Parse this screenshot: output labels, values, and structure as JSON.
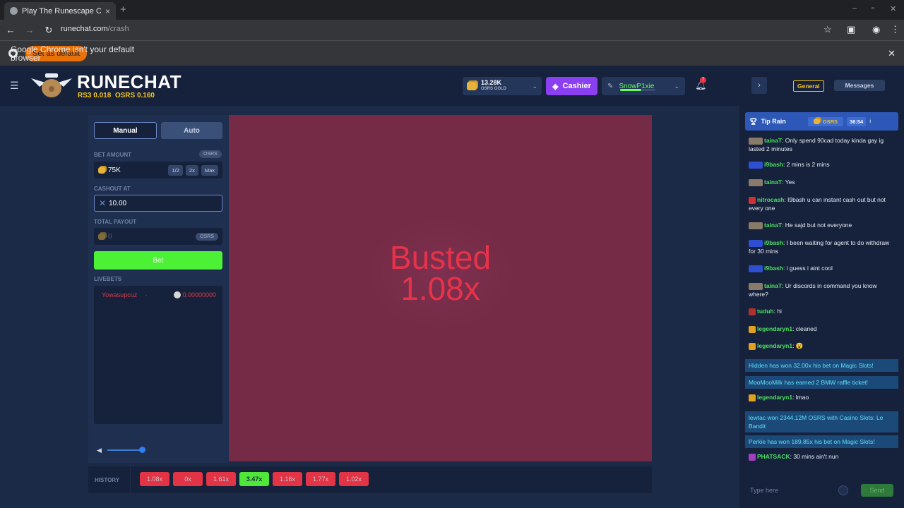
{
  "browser": {
    "tab_title": "Play The Runescape Cra",
    "tab_close": "×",
    "new_tab": "+",
    "minimize": "–",
    "maximize": "▫",
    "close": "✕",
    "url_host": "runechat.com",
    "url_path": "/crash",
    "infobar_message": "Google Chrome isn't your default browser",
    "set_default_label": "Set as default"
  },
  "header": {
    "logo_text": "RUNECHAT",
    "rs3_price": "RS3 0.018",
    "osrs_price": "OSRS 0.160",
    "balance_amount": "13.28K",
    "balance_label": "OSRS GOLD",
    "cashier_label": "Cashier",
    "username": "SnowP1xie",
    "notification_count": "7"
  },
  "bet_panel": {
    "tabs": [
      "Manual",
      "Auto"
    ],
    "active_tab": "Manual",
    "bet_amount_label": "BET AMOUNT",
    "bet_currency": "OSRS",
    "bet_amount_value": "75K",
    "bet_buttons": [
      "1/2",
      "2x",
      "Max"
    ],
    "cashout_label": "CASHOUT AT",
    "cashout_value": "10.00",
    "total_payout_label": "TOTAL PAYOUT",
    "total_payout_value": "0",
    "payout_currency": "OSRS",
    "bet_button_label": "Bet",
    "livebets_label": "LIVEBETS",
    "livebets": [
      {
        "user": "Yowasupcuz",
        "status": "-",
        "amount": "0.00000000"
      }
    ],
    "volume_percent": 100
  },
  "game": {
    "status": "Busted",
    "multiplier": "1.08x"
  },
  "history": {
    "label": "HISTORY",
    "items": [
      {
        "value": "1.08x",
        "win": false
      },
      {
        "value": "0x",
        "win": false
      },
      {
        "value": "1.61x",
        "win": false
      },
      {
        "value": "3.47x",
        "win": true
      },
      {
        "value": "1.16x",
        "win": false
      },
      {
        "value": "1.77x",
        "win": false
      },
      {
        "value": "1.02x",
        "win": false
      }
    ]
  },
  "chat": {
    "tab_general": "General",
    "tab_messages": "Messages",
    "tip_rain_label": "Tip Rain",
    "tip_rain_currency": "OSRS",
    "tip_rain_timer": "36:54",
    "tip_rain_info": "i",
    "input_placeholder": "Type here",
    "send_label": "Send",
    "messages": [
      {
        "user": "tainaT",
        "text": ": Only spend 90cad today kinda gay ig lasted 2 minutes"
      },
      {
        "user": "i9bash",
        "text": ": 2 mins is 2 mins"
      },
      {
        "user": "tainaT",
        "text": ": Yes"
      },
      {
        "user": "nitrocash",
        "text": ": I9bash u can instant cash out but not every one"
      },
      {
        "user": "tainaT",
        "text": ": He sajd but not everyone"
      },
      {
        "user": "i9bash",
        "text": ": I been waiting for agent to do withdraw for 30 mins"
      },
      {
        "user": "i9bash",
        "text": ": i guess i aint cool"
      },
      {
        "user": "tainaT",
        "text": ": Ur discords in command you know where?"
      },
      {
        "user": "tuduh",
        "text": ": hi"
      },
      {
        "user": "legendaryn1",
        "text": ": cleaned"
      },
      {
        "user": "legendaryn1",
        "text": ": 😮"
      },
      {
        "system": "Hidden has won 32.00x his bet on Magic Slots!"
      },
      {
        "system": "MooMooMilk has earned 2 BMW raffle ticket!"
      },
      {
        "user": "legendaryn1",
        "text": ": lmao"
      },
      {
        "system": "lewtac won 2344.12M OSRS with Casino Slots: Le Bandit"
      },
      {
        "system": "Perkie has won 189.85x his bet on Magic Slots!"
      },
      {
        "user": "PHATSACK",
        "text": ": 30 mins ain't nun"
      }
    ]
  }
}
